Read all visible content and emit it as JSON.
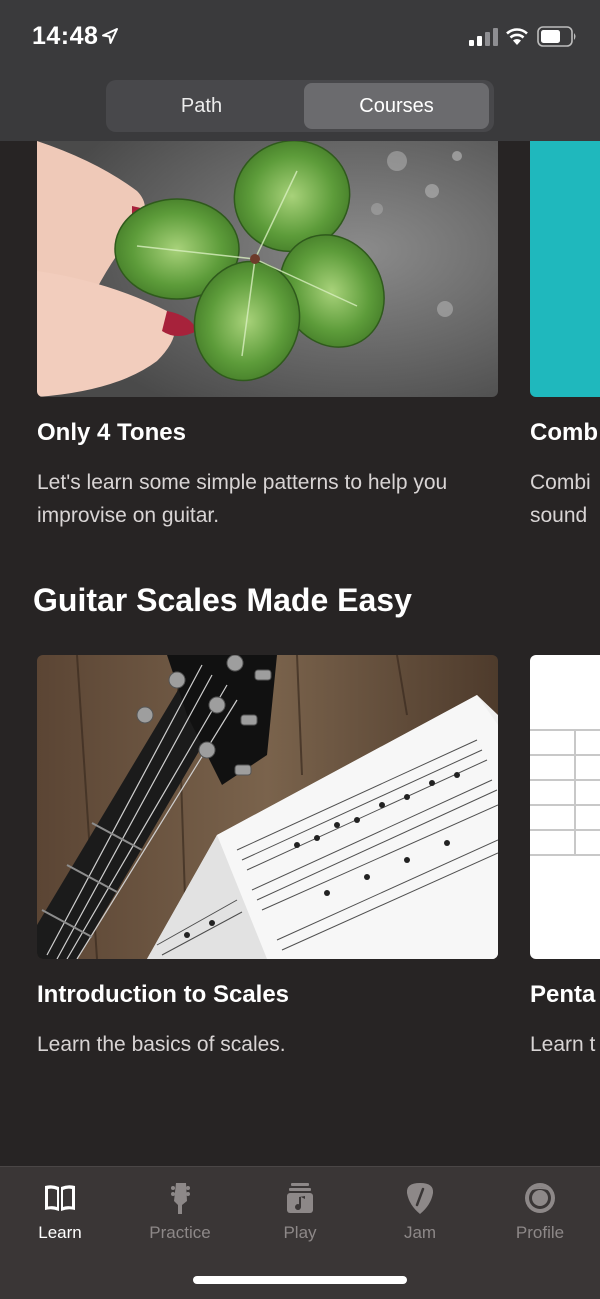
{
  "status_bar": {
    "time": "14:48"
  },
  "segmented_control": {
    "path_label": "Path",
    "courses_label": "Courses",
    "selected": "Courses"
  },
  "sections": [
    {
      "title": "",
      "cards": [
        {
          "title": "Only 4 Tones",
          "description": "Let's learn some simple patterns to help you improvise on guitar.",
          "image": "four-leaf-clover-photo"
        },
        {
          "title": "Comb",
          "description": "Combi sound",
          "image": "teal-cover",
          "partially_visible": true
        }
      ]
    },
    {
      "title": "Guitar Scales Made Easy",
      "cards": [
        {
          "title": "Introduction to Scales",
          "description": "Learn the basics of scales.",
          "image": "guitar-and-sheet-music-photo"
        },
        {
          "title": "Penta",
          "description": "Learn t",
          "image": "fretboard-diagram",
          "partially_visible": true
        }
      ]
    }
  ],
  "tabbar": {
    "active": "Learn",
    "items": [
      {
        "label": "Learn",
        "icon": "book-icon"
      },
      {
        "label": "Practice",
        "icon": "guitar-headstock-icon"
      },
      {
        "label": "Play",
        "icon": "music-library-icon"
      },
      {
        "label": "Jam",
        "icon": "guitar-pick-icon"
      },
      {
        "label": "Profile",
        "icon": "avatar-icon"
      }
    ]
  },
  "colors": {
    "background": "#272424",
    "header": "#3a3a3c",
    "segment_selected": "#6b6b6e",
    "tab_inactive": "#8d8888",
    "teal_card": "#1fb8bd"
  }
}
